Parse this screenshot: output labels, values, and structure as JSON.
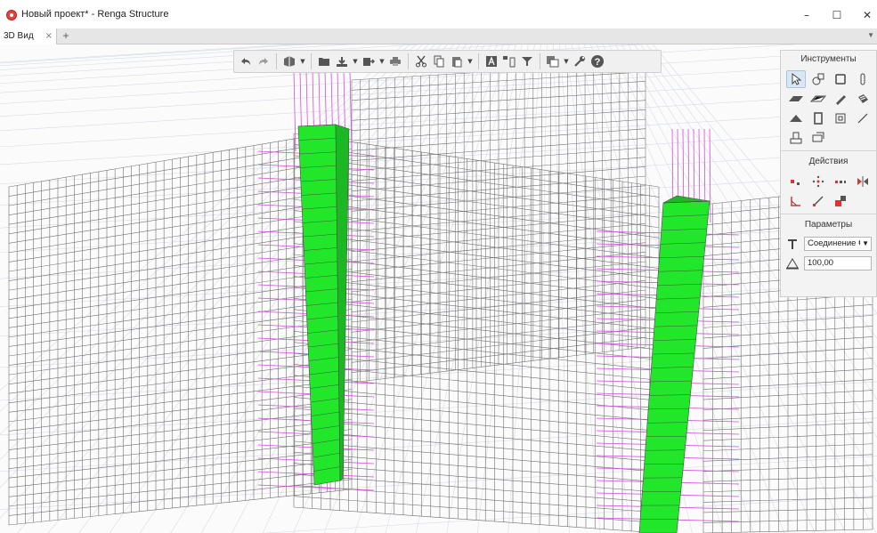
{
  "window": {
    "title": "Новый проект* - Renga Structure",
    "minimize": "–",
    "maximize": "☐",
    "close": "✕"
  },
  "tabs": {
    "active_label": "3D Вид",
    "close_glyph": "×",
    "add_glyph": "+",
    "menu_glyph": "▼"
  },
  "toolbar": {
    "buttons": [
      "undo-icon",
      "redo-icon",
      "3d-view-icon",
      "open-icon",
      "save-icon",
      "export-icon",
      "print-icon",
      "cut-icon",
      "copy-icon",
      "paste-icon",
      "text-icon",
      "align-icon",
      "filter-icon",
      "layers-icon",
      "settings-wrench-icon",
      "help-icon"
    ]
  },
  "panel": {
    "tools_title": "Инструменты",
    "actions_title": "Действия",
    "params_title": "Параметры",
    "connection_value": "Соединение €",
    "dropdown_glyph": "▼",
    "length_value": "100,00"
  },
  "colors": {
    "column_green": "#22e62a",
    "rebar_magenta": "#d14ddb",
    "mesh_grey": "#707070",
    "grid_line": "#d7dce4"
  }
}
